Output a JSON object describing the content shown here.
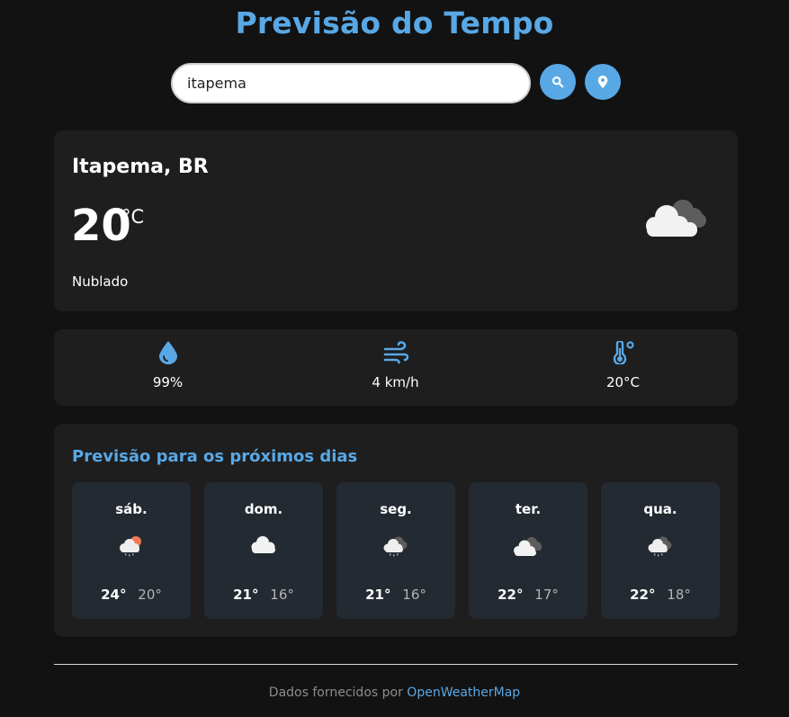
{
  "app": {
    "title": "Previsão do Tempo",
    "accent_color": "#58a8e6",
    "background_color": "#121212",
    "card_color": "#1e1e1e"
  },
  "search": {
    "value": "itapema",
    "search_icon": "search-icon",
    "location_icon": "location-pin-icon"
  },
  "current": {
    "location": "Itapema, BR",
    "temperature": "20",
    "unit": "°C",
    "description": "Nublado",
    "icon": "cloudy-icon"
  },
  "details": [
    {
      "icon": "humidity-drop-icon",
      "value": "99%"
    },
    {
      "icon": "wind-icon",
      "value": "4 km/h"
    },
    {
      "icon": "thermometer-icon",
      "value": "20°C"
    }
  ],
  "forecast": {
    "title": "Previsão para os próximos dias",
    "days": [
      {
        "name": "sáb.",
        "icon": "sun-cloud-rain-icon",
        "max": "24°",
        "min": "20°"
      },
      {
        "name": "dom.",
        "icon": "cloud-icon",
        "max": "21°",
        "min": "16°"
      },
      {
        "name": "seg.",
        "icon": "cloud-rain-icon",
        "max": "21°",
        "min": "16°"
      },
      {
        "name": "ter.",
        "icon": "cloudy-icon",
        "max": "22°",
        "min": "17°"
      },
      {
        "name": "qua.",
        "icon": "cloud-rain-icon",
        "max": "22°",
        "min": "18°"
      }
    ]
  },
  "footer": {
    "text": "Dados fornecidos por",
    "link": "OpenWeatherMap"
  }
}
